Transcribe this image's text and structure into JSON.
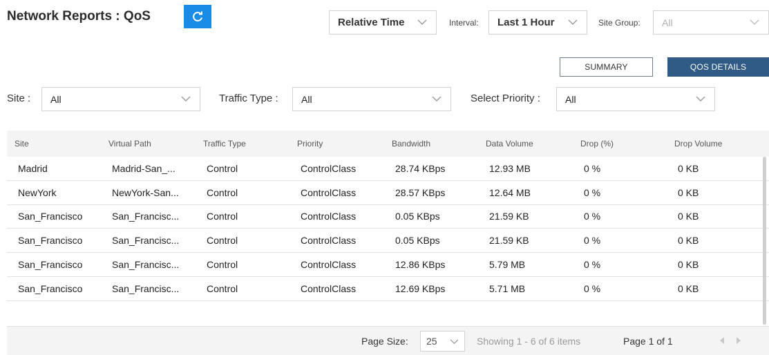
{
  "header": {
    "title": "Network Reports : QoS",
    "refresh_icon": "refresh-icon",
    "time_mode": "Relative Time",
    "interval_label": "Interval:",
    "interval_value": "Last 1 Hour",
    "site_group_label": "Site Group:",
    "site_group_value": "All"
  },
  "tabs": {
    "summary": "SUMMARY",
    "qos_details": "QOS DETAILS"
  },
  "filters": {
    "site_label": "Site :",
    "site_value": "All",
    "traffic_label": "Traffic Type :",
    "traffic_value": "All",
    "priority_label": "Select Priority :",
    "priority_value": "All"
  },
  "table": {
    "columns": [
      "Site",
      "Virtual Path",
      "Traffic Type",
      "Priority",
      "Bandwidth",
      "Data Volume",
      "Drop (%)",
      "Drop Volume"
    ],
    "rows": [
      [
        "Madrid",
        "Madrid-San_...",
        "Control",
        "ControlClass",
        "28.74 KBps",
        "12.93 MB",
        "0 %",
        "0 KB"
      ],
      [
        "NewYork",
        "NewYork-San...",
        "Control",
        "ControlClass",
        "28.57 KBps",
        "12.64 MB",
        "0 %",
        "0 KB"
      ],
      [
        "San_Francisco",
        "San_Francisc...",
        "Control",
        "ControlClass",
        "0.05 KBps",
        "21.59 KB",
        "0 %",
        "0 KB"
      ],
      [
        "San_Francisco",
        "San_Francisc...",
        "Control",
        "ControlClass",
        "0.05 KBps",
        "21.59 KB",
        "0 %",
        "0 KB"
      ],
      [
        "San_Francisco",
        "San_Francisc...",
        "Control",
        "ControlClass",
        "12.86 KBps",
        "5.79 MB",
        "0 %",
        "0 KB"
      ],
      [
        "San_Francisco",
        "San_Francisc...",
        "Control",
        "ControlClass",
        "12.69 KBps",
        "5.71 MB",
        "0 %",
        "0 KB"
      ]
    ]
  },
  "pagination": {
    "page_size_label": "Page Size:",
    "page_size_value": "25",
    "showing": "Showing 1 - 6 of 6 items",
    "page": "Page 1 of 1"
  },
  "colors": {
    "accent": "#1a8ce6",
    "active_tab": "#2f5b86"
  }
}
